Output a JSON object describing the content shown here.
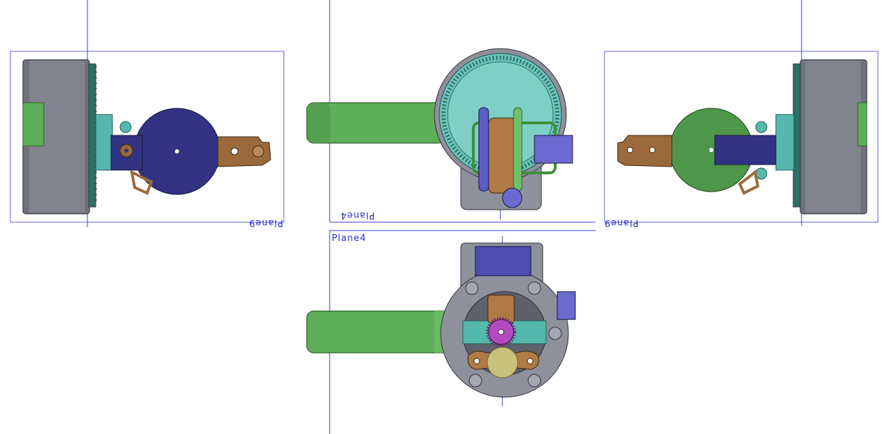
{
  "views": {
    "left": {
      "plane_label": "Plane9"
    },
    "top": {
      "plane_label": "Plane4"
    },
    "bottom": {
      "plane_label": "Plane4"
    },
    "right": {
      "plane_label": "Plane9"
    }
  },
  "colors": {
    "plane_line": "#3a3ad8",
    "housing_gray": "#7c7e8c",
    "housing_dark": "#55575f",
    "gear_teal": "#54b8ad",
    "disc_navy": "#323282",
    "handle_green": "#5fae5a",
    "bracket_bronze": "#9b6a3c",
    "servo_blue": "#6a6ad0",
    "pinion_magenta": "#b44ac0",
    "cam_yellow": "#c8c27a"
  }
}
